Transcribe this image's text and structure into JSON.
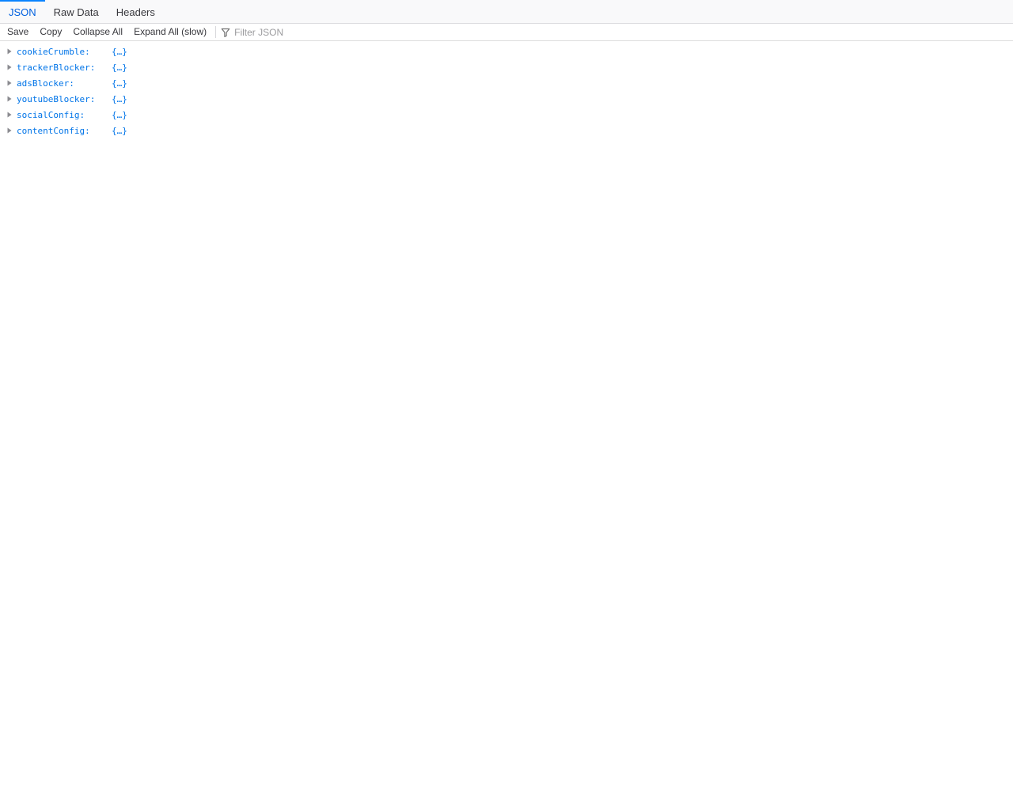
{
  "tabs": {
    "items": [
      {
        "label": "JSON",
        "active": true
      },
      {
        "label": "Raw Data",
        "active": false
      },
      {
        "label": "Headers",
        "active": false
      }
    ]
  },
  "toolbar": {
    "buttons": [
      {
        "label": "Save"
      },
      {
        "label": "Copy"
      },
      {
        "label": "Collapse All"
      },
      {
        "label": "Expand All (slow)"
      }
    ],
    "filter": {
      "icon": "funnel-icon",
      "placeholder": "Filter JSON"
    }
  },
  "tree": {
    "expander_icon": "triangle-right",
    "rows": [
      {
        "key": "cookieCrumble:",
        "value": "{…}"
      },
      {
        "key": "trackerBlocker:",
        "value": "{…}"
      },
      {
        "key": "adsBlocker:",
        "value": "{…}"
      },
      {
        "key": "youtubeBlocker:",
        "value": "{…}"
      },
      {
        "key": "socialConfig:",
        "value": "{…}"
      },
      {
        "key": "contentConfig:",
        "value": "{…}"
      }
    ]
  },
  "colors": {
    "accent_blue": "#0a84ff",
    "active_tab_text": "#0060df",
    "key_blue": "#0074e8",
    "toolbar_text": "#38383d"
  }
}
